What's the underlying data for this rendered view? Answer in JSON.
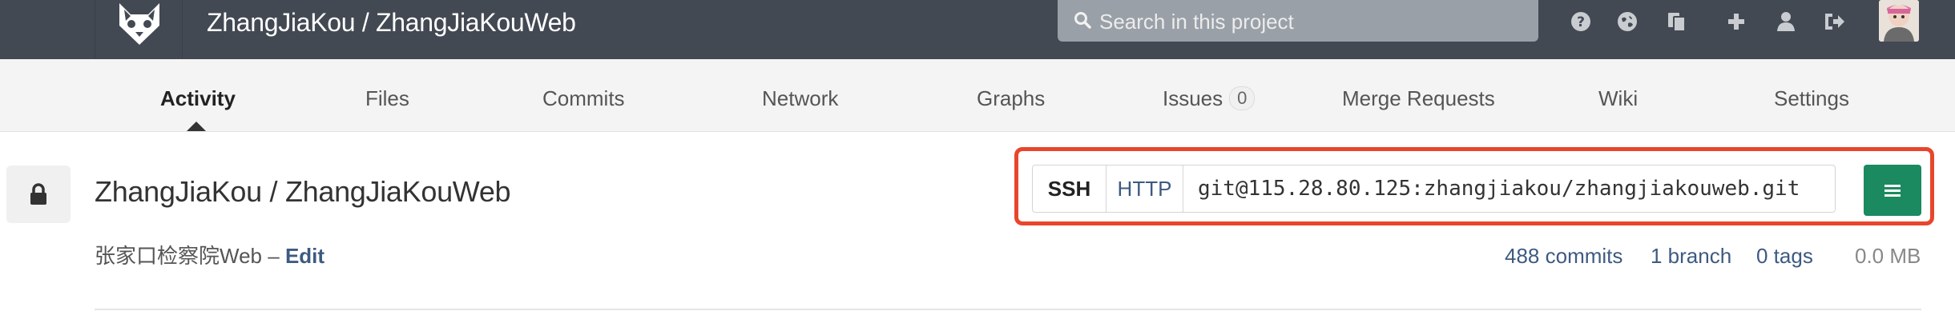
{
  "header": {
    "project_path": "ZhangJiaKou / ZhangJiaKouWeb",
    "search_placeholder": "Search in this project",
    "icons": [
      "help-icon",
      "explore-icon",
      "snippets-icon",
      "new-project-icon",
      "profile-icon",
      "sign-out-icon"
    ]
  },
  "nav": {
    "tabs": [
      {
        "label": "Activity",
        "active": true
      },
      {
        "label": "Files"
      },
      {
        "label": "Commits"
      },
      {
        "label": "Network"
      },
      {
        "label": "Graphs"
      },
      {
        "label": "Issues",
        "badge": "0"
      },
      {
        "label": "Merge Requests"
      },
      {
        "label": "Wiki"
      },
      {
        "label": "Settings"
      }
    ]
  },
  "project": {
    "name": "ZhangJiaKou / ZhangJiaKouWeb",
    "description": "张家口检察院Web",
    "separator": "–",
    "edit_label": "Edit",
    "clone": {
      "ssh_label": "SSH",
      "http_label": "HTTP",
      "url": "git@115.28.80.125:zhangjiakou/zhangjiakouweb.git"
    },
    "stats": {
      "commits": "488 commits",
      "branches": "1 branch",
      "tags": "0 tags",
      "size": "0.0 MB"
    }
  },
  "colors": {
    "header_bg": "#434953",
    "nav_bg": "#f4f4f4",
    "link": "#3d5a80",
    "highlight": "#e8462b",
    "menu_button": "#1b8a60"
  }
}
